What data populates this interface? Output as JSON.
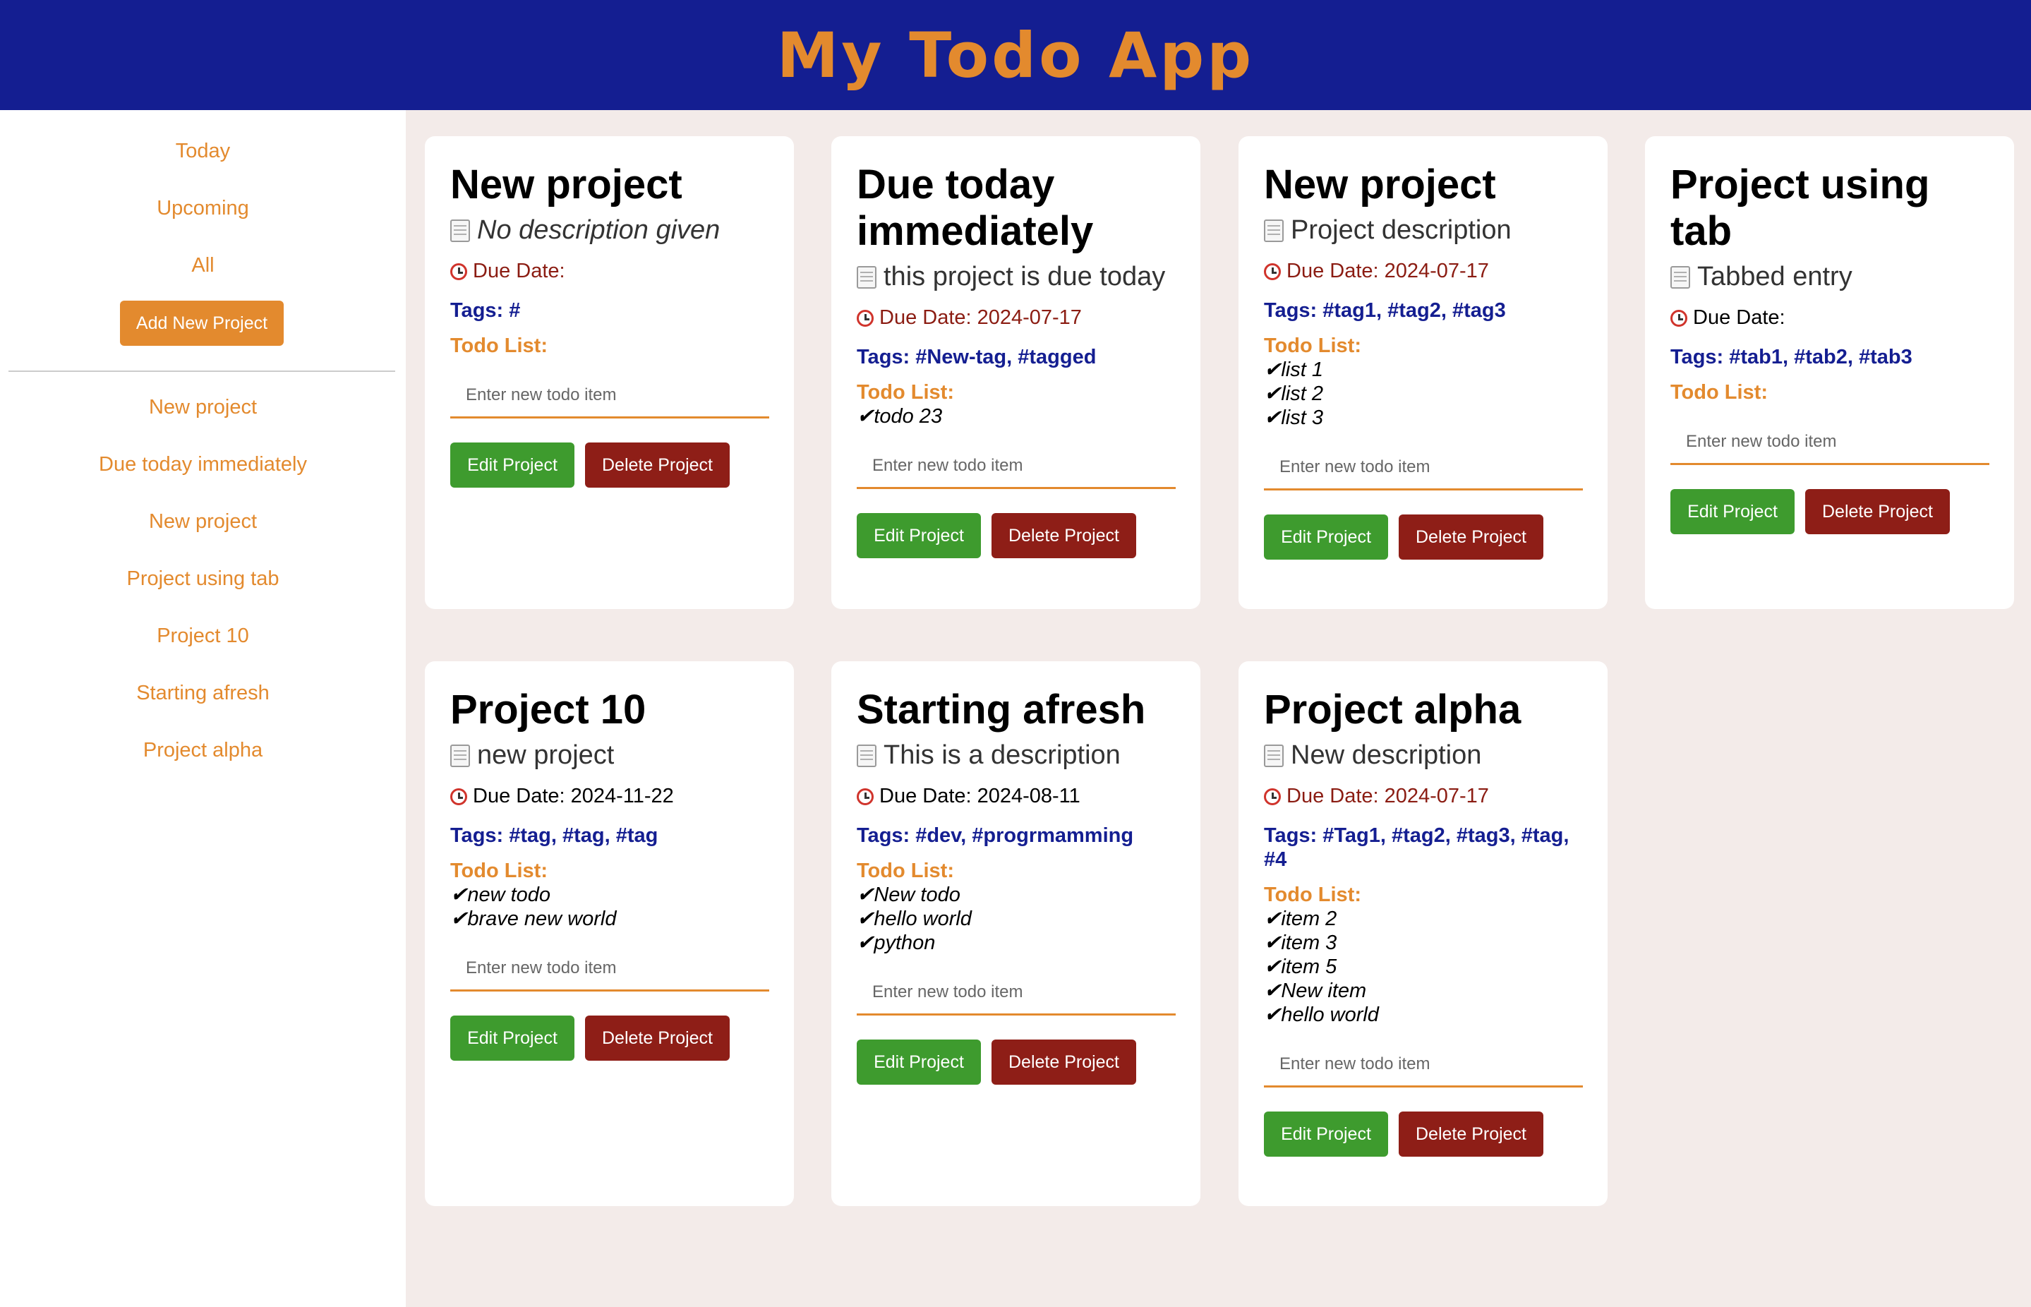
{
  "app": {
    "title": "My Todo App"
  },
  "sidebar": {
    "views": [
      "Today",
      "Upcoming",
      "All"
    ],
    "add_button": "Add New Project",
    "projects": [
      "New project",
      "Due today immediately",
      "New project",
      "Project using tab",
      "Project 10",
      "Starting afresh",
      "Project alpha"
    ]
  },
  "labels": {
    "due": "Due Date:",
    "tags": "Tags:",
    "todo": "Todo List:",
    "input_placeholder": "Enter new todo item",
    "edit": "Edit Project",
    "delete": "Delete Project"
  },
  "icons": {
    "description": "notepad-icon",
    "due": "alarm-clock-icon",
    "check": "✔"
  },
  "colors": {
    "header_bg": "#141e91",
    "accent": "#e38a2e",
    "tags": "#141e91",
    "due_red": "#8b1c12",
    "edit_btn": "#3e9b2e",
    "delete_btn": "#8e1e17",
    "page_bg": "#f3ebe9"
  },
  "cards": [
    {
      "title": "New project",
      "description": "No description given",
      "due": "",
      "tags": "#",
      "todos": []
    },
    {
      "title": "Due today immediately",
      "description": "this project is due today",
      "due": "2024-07-17",
      "tags": "#New-tag, #tagged",
      "todos": [
        "todo 23"
      ]
    },
    {
      "title": "New project",
      "description": "Project description",
      "due": "2024-07-17",
      "tags": "#tag1, #tag2, #tag3",
      "todos": [
        "list 1",
        "list 2",
        "list 3"
      ]
    },
    {
      "title": "Project using tab",
      "description": "Tabbed entry",
      "due": "",
      "tags": "#tab1, #tab2, #tab3",
      "todos": []
    },
    {
      "title": "Project 10",
      "description": "new project",
      "due": "2024-11-22",
      "tags": "#tag, #tag, #tag",
      "todos": [
        "new todo",
        "brave new world"
      ]
    },
    {
      "title": "Starting afresh",
      "description": "This is a description",
      "due": "2024-08-11",
      "tags": "#dev, #progrmamming",
      "todos": [
        "New todo",
        "hello world",
        "python"
      ]
    },
    {
      "title": "Project alpha",
      "description": "New description",
      "due": "2024-07-17",
      "tags": "#Tag1, #tag2, #tag3, #tag, #4",
      "todos": [
        "item 2",
        "item 3",
        "item 5",
        "New item",
        "hello world"
      ]
    }
  ]
}
